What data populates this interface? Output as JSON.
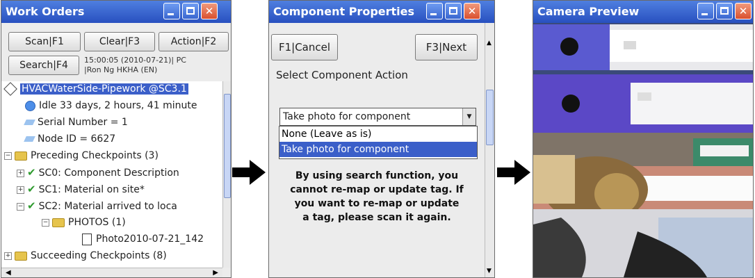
{
  "work_orders": {
    "title": "Work Orders",
    "buttons": {
      "scan": "Scan|F1",
      "clear": "Clear|F3",
      "action": "Action|F2",
      "search": "Search|F4"
    },
    "meta_line1": "15:00:05 (2010-07-21)| PC",
    "meta_line2": "|Ron Ng HKHA (EN)",
    "tree": {
      "root": "HVACWaterSide-Pipework @SC3.1",
      "idle": "Idle 33 days, 2 hours, 41 minute",
      "serial": "Serial Number = 1",
      "node": "Node ID = 6627",
      "preceding": "Preceding Checkpoints (3)",
      "sc0": "SC0: Component Description",
      "sc1": "SC1: Material on site*",
      "sc2": "SC2: Material arrived to loca",
      "photos": "PHOTOS (1)",
      "photo_file": "Photo2010-07-21_142",
      "succeeding": "Succeeding Checkpoints (8)"
    }
  },
  "component_properties": {
    "title": "Component Properties",
    "cancel": "F1|Cancel",
    "next": "F3|Next",
    "label": "Select Component Action",
    "combo_value": "Take photo for component",
    "options": [
      "None (Leave as is)",
      "Take photo for component"
    ],
    "warning": [
      "By using search function, you",
      "cannot re-map or update tag. If",
      "you want to re-map or update",
      "a tag, please scan it again."
    ]
  },
  "camera_preview": {
    "title": "Camera Preview"
  },
  "colors": {
    "titlebar": "#2f5bd0",
    "selection": "#3b5fc9",
    "close": "#d9502e"
  }
}
